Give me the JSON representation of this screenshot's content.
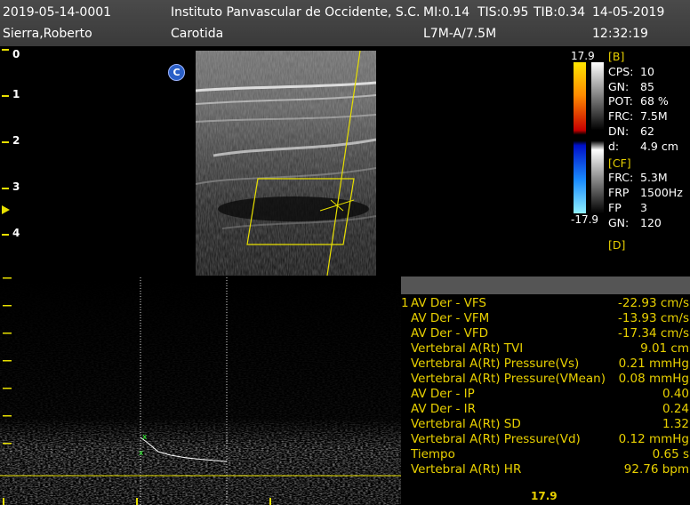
{
  "header": {
    "patient_id": "2019-05-14-0001",
    "institution": "Instituto Panvascular de Occidente, S.C.",
    "mi": "MI:0.14",
    "tis": "TIS:0.95",
    "tib": "TIB:0.34",
    "date": "14-05-2019",
    "patient_name": "Sierra,Roberto",
    "exam": "Carotida",
    "probe": "L7M-A/7.5M",
    "time": "12:32:19"
  },
  "depth_scale": [
    "0",
    "1",
    "2",
    "3",
    "4"
  ],
  "color_mode_badge": "C",
  "colorbar": {
    "max": "17.9",
    "min": "-17.9"
  },
  "b_mode": {
    "section": "[B]",
    "rows": [
      {
        "k": "CPS:",
        "v": "10"
      },
      {
        "k": "GN:",
        "v": "85"
      },
      {
        "k": "POT:",
        "v": "68 %"
      },
      {
        "k": "FRC:",
        "v": "7.5M"
      },
      {
        "k": "DN:",
        "v": "62"
      },
      {
        "k": "d:",
        "v": "4.9 cm"
      }
    ]
  },
  "cf_mode": {
    "section": "[CF]",
    "rows": [
      {
        "k": "FRC:",
        "v": "5.3M"
      },
      {
        "k": "FRP",
        "v": "1500Hz"
      },
      {
        "k": "FP",
        "v": "3"
      },
      {
        "k": "GN:",
        "v": "120"
      }
    ]
  },
  "d_mode": {
    "section": "[D]"
  },
  "measurements": [
    {
      "idx": "1",
      "label": "AV Der - VFS",
      "value": "-22.93 cm/s"
    },
    {
      "idx": "",
      "label": "AV Der - VFM",
      "value": "-13.93 cm/s"
    },
    {
      "idx": "",
      "label": "AV Der - VFD",
      "value": "-17.34 cm/s"
    },
    {
      "idx": "",
      "label": "Vertebral A(Rt) TVI",
      "value": "9.01 cm"
    },
    {
      "idx": "",
      "label": "Vertebral A(Rt) Pressure(Vs)",
      "value": "0.21 mmHg"
    },
    {
      "idx": "",
      "label": "Vertebral A(Rt) Pressure(VMean)",
      "value": "0.08 mmHg"
    },
    {
      "idx": "",
      "label": "AV Der - IP",
      "value": "0.40"
    },
    {
      "idx": "",
      "label": "AV Der - IR",
      "value": "0.24"
    },
    {
      "idx": "",
      "label": "Vertebral A(Rt) SD",
      "value": "1.32"
    },
    {
      "idx": "",
      "label": "Vertebral A(Rt) Pressure(Vd)",
      "value": "0.12 mmHg"
    },
    {
      "idx": "",
      "label": "Tiempo",
      "value": "0.65 s"
    },
    {
      "idx": "",
      "label": "Vertebral A(Rt) HR",
      "value": "92.76 bpm"
    }
  ],
  "spectral_footer": "17.9",
  "colors": {
    "accent": "#e8d000",
    "header_bg": "#444444"
  }
}
